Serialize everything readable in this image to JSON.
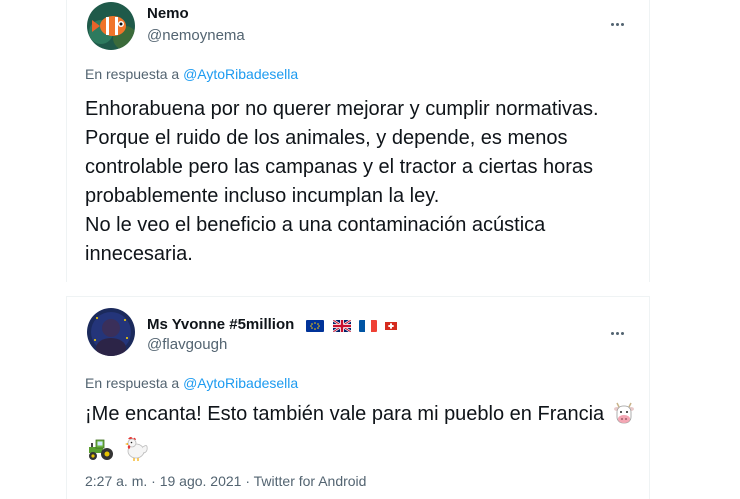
{
  "tweets": [
    {
      "name": "Nemo",
      "handle": "@nemoynema",
      "reply_prefix": "En respuesta a",
      "reply_to": "@AytoRibadesella",
      "lines": [
        "Enhorabuena por no querer mejorar y cumplir normativas. Porque el ruido de los animales, y depende, es menos controlable pero las campanas y el tractor a ciertas horas probablemente incluso incumplan la ley.",
        "No le veo el beneficio a una contaminación acústica innecesaria."
      ]
    },
    {
      "name": "Ms Yvonne #5million",
      "handle": "@flavgough",
      "reply_prefix": "En respuesta a",
      "reply_to": "@AytoRibadesella",
      "text": "¡Me encanta! Esto también vale para mi pueblo en Francia",
      "flags": [
        "eu-flag",
        "uk-flag",
        "france-flag",
        "switzerland-flag"
      ],
      "emojis": [
        "cow-face-icon",
        "tractor-icon",
        "rooster-icon"
      ],
      "meta": "2:27 a. m. · 19 ago. 2021 · Twitter for Android"
    }
  ],
  "colors": {
    "link": "#1d9bf0",
    "secondary": "#536471",
    "text": "#0f1419"
  }
}
